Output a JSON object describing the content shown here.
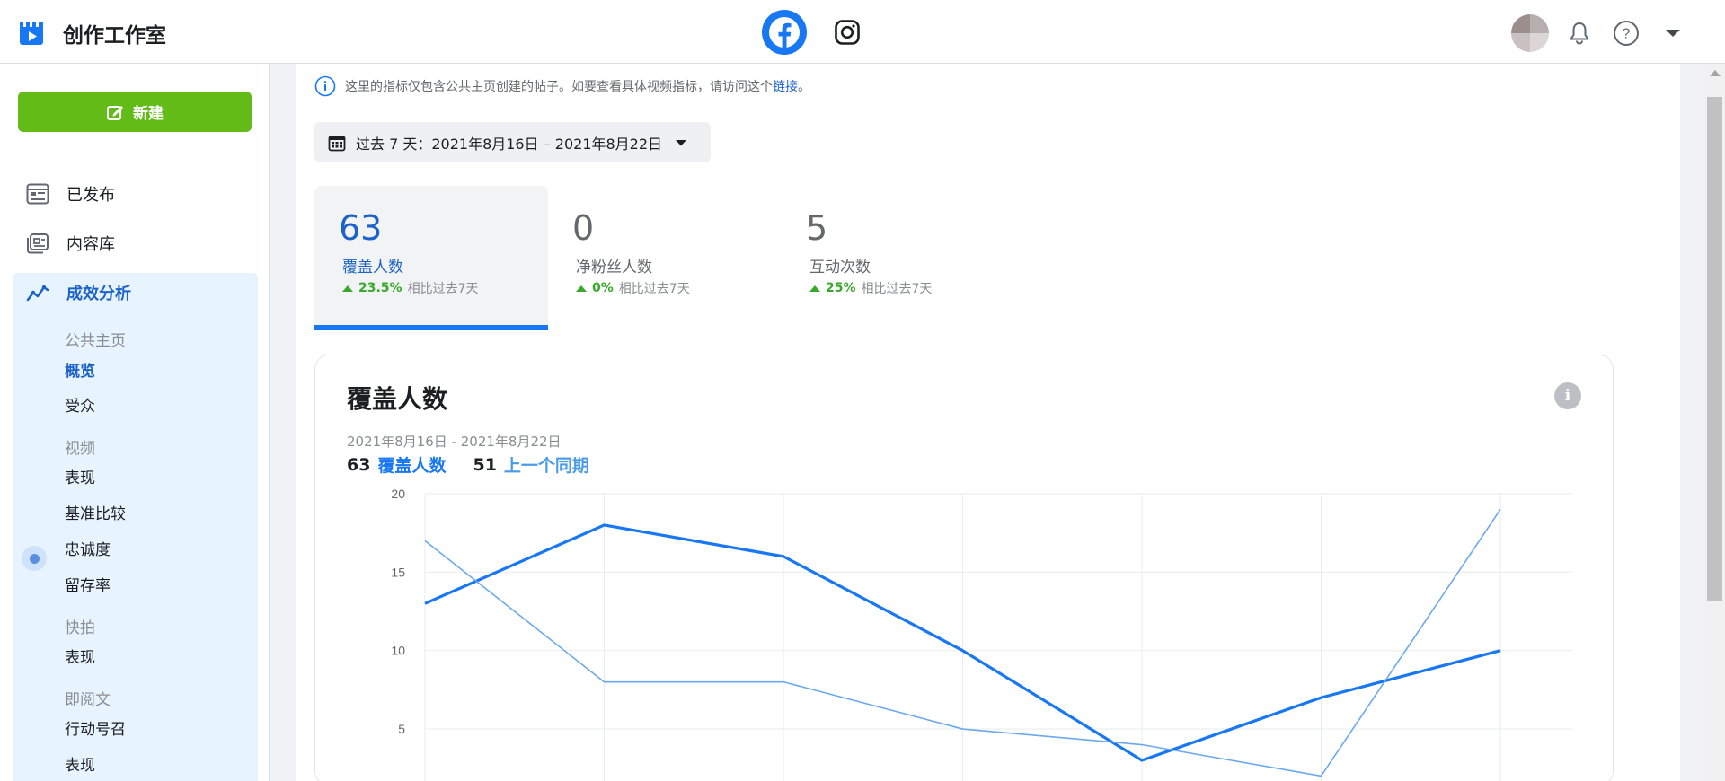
{
  "header": {
    "title": "创作工作室",
    "platforms": [
      "facebook",
      "instagram"
    ],
    "icons": [
      "bell-icon",
      "help-icon",
      "caret-down-icon"
    ]
  },
  "sidebar": {
    "new_label": "新建",
    "items": [
      {
        "label": "已发布",
        "icon": "published-icon"
      },
      {
        "label": "内容库",
        "icon": "library-icon"
      },
      {
        "label": "成效分析",
        "icon": "insights-icon"
      }
    ],
    "sub_sections": [
      {
        "heading": "公共主页",
        "items": [
          "概览",
          "受众"
        ]
      },
      {
        "heading": "视频",
        "items": [
          "表现",
          "基准比较",
          "忠诚度",
          "留存率"
        ]
      },
      {
        "heading": "快拍",
        "items": [
          "表现"
        ]
      },
      {
        "heading": "即阅文",
        "items": [
          "行动号召",
          "表现"
        ]
      }
    ]
  },
  "notice": {
    "text": "这里的指标仅包含公共主页创建的帖子。如要查看具体视频指标，请访问这个",
    "link": "链接",
    "tail": "。"
  },
  "date_range": {
    "label": "过去 7 天：2021年8月16日 – 2021年8月22日"
  },
  "metrics": [
    {
      "value": "63",
      "name": "覆盖人数",
      "pct": "23.5%",
      "compare": "相比过去7天"
    },
    {
      "value": "0",
      "name": "净粉丝人数",
      "pct": "0%",
      "compare": "相比过去7天"
    },
    {
      "value": "5",
      "name": "互动次数",
      "pct": "25%",
      "compare": "相比过去7天"
    }
  ],
  "chart_card": {
    "title": "覆盖人数",
    "range": "2021年8月16日 - 2021年8月22日",
    "legend_current_value": "63",
    "legend_current_label": "覆盖人数",
    "legend_previous_value": "51",
    "legend_previous_label": "上一个同期"
  },
  "chart_data": {
    "type": "line",
    "x": [
      1,
      2,
      3,
      4,
      5,
      6,
      7
    ],
    "ylim": [
      0,
      20
    ],
    "yticks": [
      5,
      10,
      15,
      20
    ],
    "series": [
      {
        "name": "覆盖人数",
        "color": "#1877f2",
        "values": [
          13,
          18,
          16,
          10,
          3,
          7,
          10
        ]
      },
      {
        "name": "上一个同期",
        "color": "#6aa9ee",
        "values": [
          17,
          8,
          8,
          5,
          4,
          2,
          19
        ]
      }
    ],
    "grid": true
  }
}
